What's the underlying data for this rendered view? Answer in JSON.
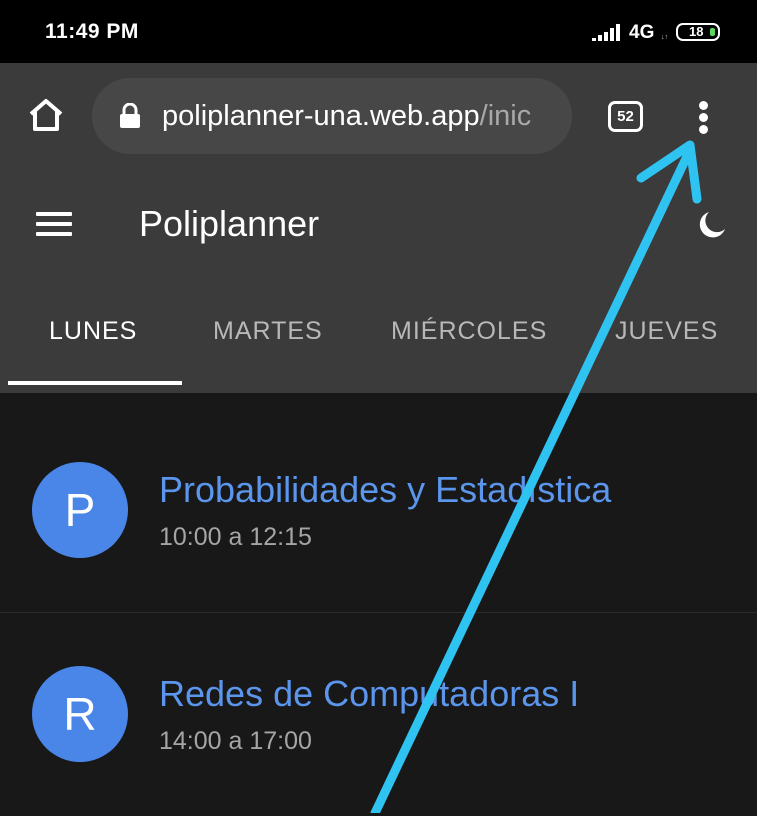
{
  "status_bar": {
    "time": "11:49 PM",
    "network": "4G",
    "battery": "18"
  },
  "browser": {
    "url_main": "poliplanner-una.web.app",
    "url_path": "/inic",
    "tab_count": "52",
    "icons": [
      "home-icon",
      "lock-icon",
      "tabs-icon",
      "menu-icon"
    ]
  },
  "app": {
    "title": "Poliplanner",
    "icons": [
      "hamburger-icon",
      "moon-icon"
    ],
    "tabs": [
      {
        "label": "LUNES"
      },
      {
        "label": "MARTES"
      },
      {
        "label": "MIÉRCOLES"
      },
      {
        "label": "JUEVES"
      }
    ],
    "items": [
      {
        "initial": "P",
        "title": "Probabilidades y Estadística",
        "time": "10:00 a 12:15"
      },
      {
        "initial": "R",
        "title": "Redes de Computadoras I",
        "time": "14:00 a 17:00"
      }
    ]
  },
  "colors": {
    "accent": "#5b95ec",
    "avatar": "#4a86e8",
    "arrow": "#2fc3f2",
    "toolbar": "#3b3b3b",
    "background": "#181818"
  }
}
